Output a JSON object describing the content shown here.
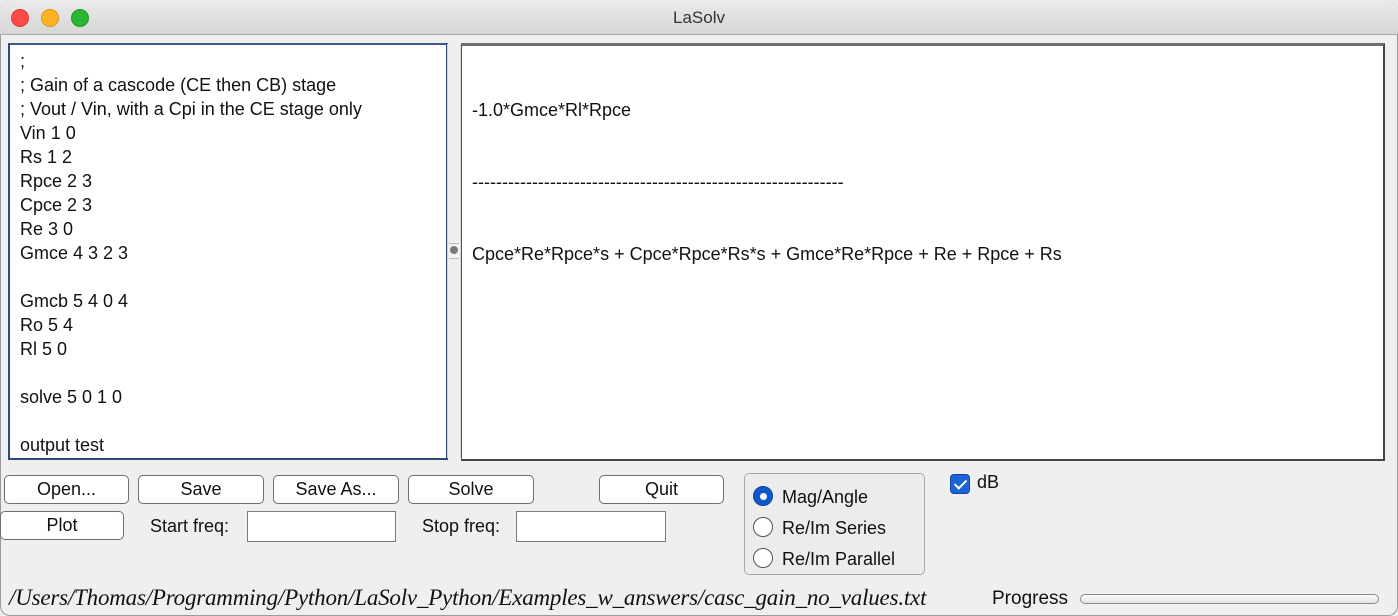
{
  "window": {
    "title": "LaSolv"
  },
  "editor": {
    "lines": [
      ";",
      "; Gain of a cascode (CE then CB) stage",
      "; Vout / Vin, with a Cpi in the CE stage only",
      "Vin 1 0",
      "Rs 1 2",
      "Rpce 2 3",
      "Cpce 2 3",
      "Re 3 0",
      "Gmce 4 3 2 3",
      "",
      "Gmcb 5 4 0 4",
      "Ro 5 4",
      "Rl 5 0",
      "",
      "solve 5 0 1 0",
      "",
      "output test"
    ]
  },
  "output": {
    "numerator": "-1.0*Gmce*Rl*Rpce",
    "divider": "--------------------------------------------------------------",
    "denominator": "Cpce*Re*Rpce*s + Cpce*Rpce*Rs*s + Gmce*Re*Rpce + Re + Rpce + Rs"
  },
  "buttons": {
    "open": "Open...",
    "save": "Save",
    "save_as": "Save As...",
    "solve": "Solve",
    "quit": "Quit",
    "plot": "Plot"
  },
  "freq": {
    "start_label": "Start freq:",
    "start_value": "",
    "stop_label": "Stop freq:",
    "stop_value": ""
  },
  "display_mode": {
    "options": [
      "Mag/Angle",
      "Re/Im Series",
      "Re/Im Parallel"
    ],
    "selected": "Mag/Angle"
  },
  "db_checkbox": {
    "label": "dB",
    "checked": true
  },
  "status": {
    "file_path": "/Users/Thomas/Programming/Python/LaSolv_Python/Examples_w_answers/casc_gain_no_values.txt",
    "progress_label": "Progress",
    "progress_percent": 0
  },
  "colors": {
    "accent": "#1d63d6",
    "editor_focus_border": "#2a4a7a"
  }
}
